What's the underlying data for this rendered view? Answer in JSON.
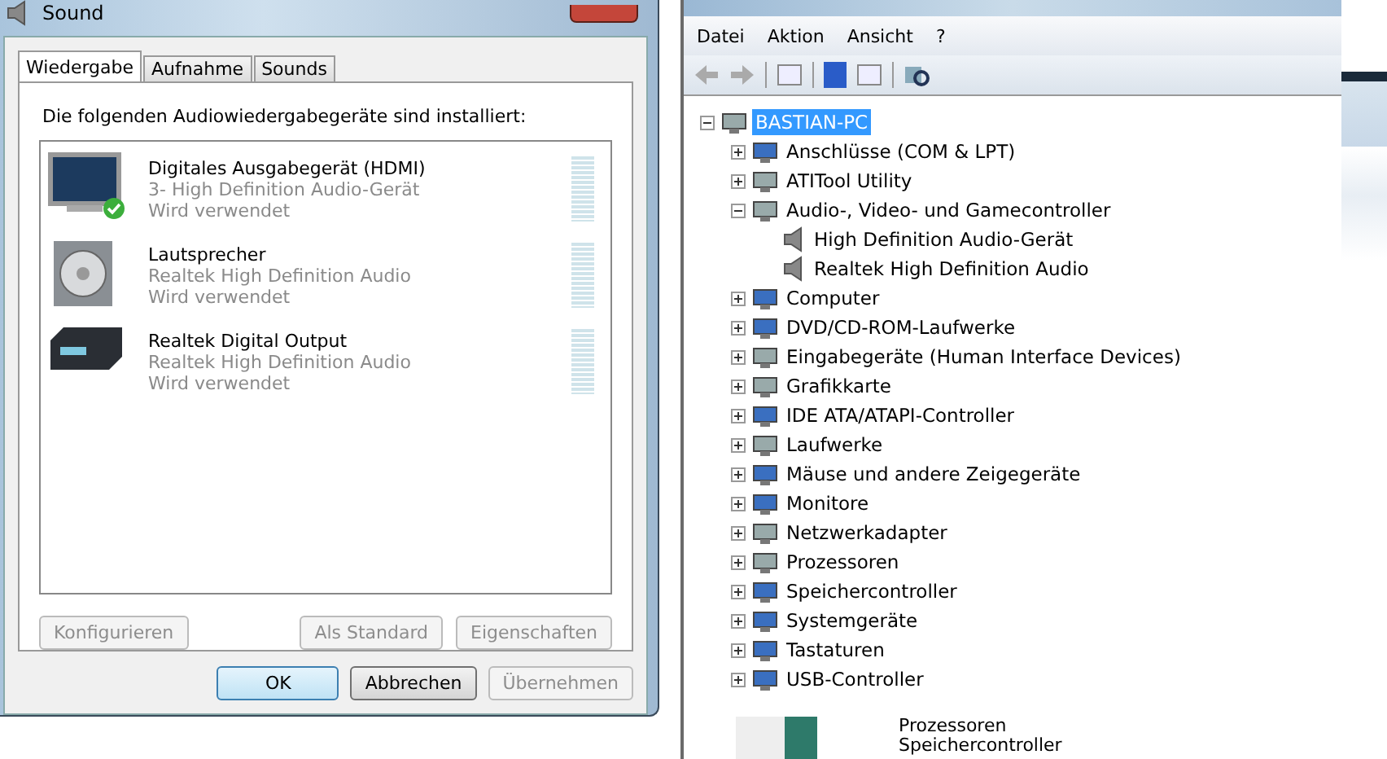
{
  "sound_dialog": {
    "title": "Sound",
    "tabs": [
      {
        "label": "Wiedergabe",
        "selected": true
      },
      {
        "label": "Aufnahme",
        "selected": false
      },
      {
        "label": "Sounds",
        "selected": false
      }
    ],
    "heading": "Die folgenden Audiowiedergabegeräte sind installiert:",
    "devices": [
      {
        "kind": "monitor",
        "name": "Digitales Ausgabegerät (HDMI)",
        "driver": "3- High Definition Audio-Gerät",
        "status": "Wird verwendet",
        "default": true
      },
      {
        "kind": "speaker",
        "name": "Lautsprecher",
        "driver": "Realtek High Definition Audio",
        "status": "Wird verwendet",
        "default": false
      },
      {
        "kind": "receiver",
        "name": "Realtek Digital Output",
        "driver": "Realtek High Definition Audio",
        "status": "Wird verwendet",
        "default": false
      }
    ],
    "panel_buttons": [
      {
        "label": "Konfigurieren",
        "disabled": true
      },
      {
        "label": "Als Standard",
        "disabled": true
      },
      {
        "label": "Eigenschaften",
        "disabled": true
      }
    ],
    "buttons": [
      {
        "label": "OK",
        "disabled": false
      },
      {
        "label": "Abbrechen",
        "disabled": false
      },
      {
        "label": "Übernehmen",
        "disabled": true
      }
    ]
  },
  "device_manager": {
    "menu": [
      "Datei",
      "Aktion",
      "Ansicht",
      "?"
    ],
    "tree": {
      "label": "BASTIAN-PC",
      "selected": true,
      "expanded": true,
      "children": [
        {
          "label": "Anschlüsse (COM & LPT)",
          "selected": false,
          "expanded": false
        },
        {
          "label": "ATITool Utility",
          "selected": false,
          "expanded": false
        },
        {
          "label": "Audio-, Video- und Gamecontroller",
          "selected": false,
          "expanded": true,
          "children": [
            {
              "label": "High Definition Audio-Gerät",
              "selected": false
            },
            {
              "label": "Realtek High Definition Audio",
              "selected": false
            }
          ]
        },
        {
          "label": "Computer",
          "selected": false,
          "expanded": false
        },
        {
          "label": "DVD/CD-ROM-Laufwerke",
          "selected": false,
          "expanded": false
        },
        {
          "label": "Eingabegeräte (Human Interface Devices)",
          "selected": false,
          "expanded": false
        },
        {
          "label": "Grafikkarte",
          "selected": false,
          "expanded": false
        },
        {
          "label": "IDE ATA/ATAPI-Controller",
          "selected": false,
          "expanded": false
        },
        {
          "label": "Laufwerke",
          "selected": false,
          "expanded": false
        },
        {
          "label": "Mäuse und andere Zeigegeräte",
          "selected": false,
          "expanded": false
        },
        {
          "label": "Monitore",
          "selected": false,
          "expanded": false
        },
        {
          "label": "Netzwerkadapter",
          "selected": false,
          "expanded": false
        },
        {
          "label": "Prozessoren",
          "selected": false,
          "expanded": false
        },
        {
          "label": "Speichercontroller",
          "selected": false,
          "expanded": false
        },
        {
          "label": "Systemgeräte",
          "selected": false,
          "expanded": false
        },
        {
          "label": "Tastaturen",
          "selected": false,
          "expanded": false
        },
        {
          "label": "USB-Controller",
          "selected": false,
          "expanded": false
        }
      ]
    }
  },
  "fragment": {
    "items": [
      "Prozessoren",
      "Speichercontroller"
    ]
  }
}
